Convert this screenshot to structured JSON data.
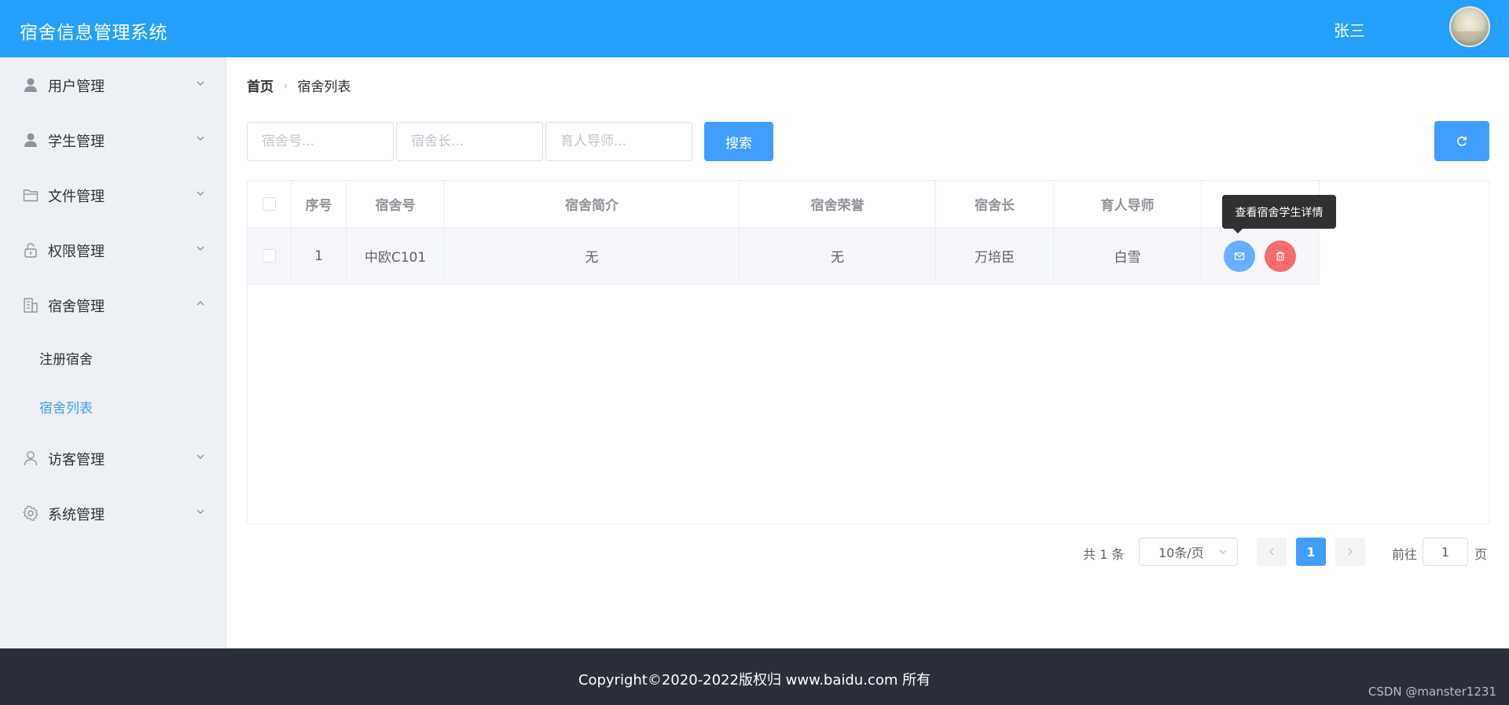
{
  "header": {
    "app_title": "宿舍信息管理系统",
    "user_name": "张三"
  },
  "sidebar": {
    "items": [
      {
        "label": "用户管理",
        "icon": "user-icon"
      },
      {
        "label": "学生管理",
        "icon": "user-icon"
      },
      {
        "label": "文件管理",
        "icon": "folder-icon"
      },
      {
        "label": "权限管理",
        "icon": "lock-icon"
      },
      {
        "label": "宿舍管理",
        "icon": "building-icon"
      },
      {
        "label": "访客管理",
        "icon": "user-outline-icon"
      },
      {
        "label": "系统管理",
        "icon": "gear-icon"
      }
    ],
    "sub_items": [
      {
        "label": "注册宿舍"
      },
      {
        "label": "宿舍列表"
      }
    ]
  },
  "breadcrumb": {
    "home": "首页",
    "current": "宿舍列表"
  },
  "search": {
    "room_placeholder": "宿舍号...",
    "leader_placeholder": "宿舍长...",
    "mentor_placeholder": "育人导师...",
    "search_label": "搜索"
  },
  "table": {
    "headers": [
      "序号",
      "宿舍号",
      "宿舍简介",
      "宿舍荣誉",
      "宿舍长",
      "育人导师"
    ],
    "rows": [
      {
        "index": "1",
        "room": "中欧C101",
        "intro": "无",
        "honor": "无",
        "leader": "万培臣",
        "mentor": "白雪"
      }
    ]
  },
  "tooltip": {
    "text": "查看宿舍学生详情"
  },
  "pagination": {
    "total": "共 1 条",
    "page_size": "10条/页",
    "current_page": "1",
    "goto_label": "前往",
    "goto_value": "1",
    "page_suffix": "页"
  },
  "footer": {
    "copyright": "Copyright©2020-2022版权归 www.baidu.com 所有",
    "watermark": "CSDN @manster1231"
  },
  "colors": {
    "header_bg": "#23a0fc",
    "primary": "#409eff",
    "danger": "#f56c6c",
    "sidebar_bg": "#edf0f5",
    "footer_bg": "#2b2f3a"
  }
}
